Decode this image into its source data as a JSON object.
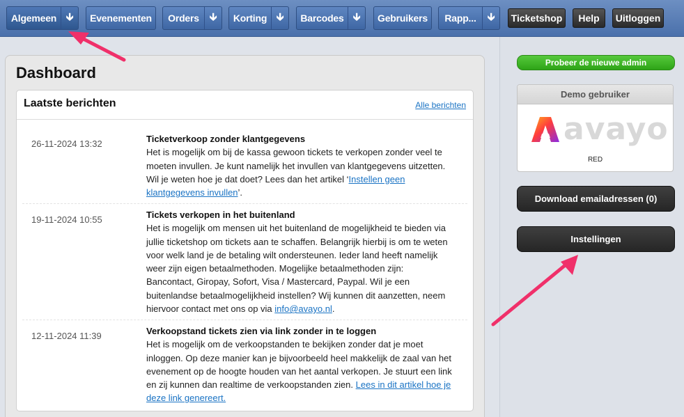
{
  "nav": {
    "items": [
      {
        "label": "Algemeen",
        "has_dropdown": true,
        "active": true
      },
      {
        "label": "Evenementen",
        "has_dropdown": false
      },
      {
        "label": "Orders",
        "has_dropdown": true
      },
      {
        "label": "Korting",
        "has_dropdown": true
      },
      {
        "label": "Barcodes",
        "has_dropdown": true
      },
      {
        "label": "Gebruikers",
        "has_dropdown": false
      },
      {
        "label": "Rapp...",
        "has_dropdown": true
      }
    ],
    "dropdown_icon": "arrow-down-icon",
    "right_buttons": [
      "Ticketshop",
      "Help",
      "Uitloggen"
    ]
  },
  "main": {
    "page_title": "Dashboard",
    "messages_card": {
      "title": "Laatste berichten",
      "all_link": "Alle berichten",
      "messages": [
        {
          "date": "26-11-2024 13:32",
          "title": "Ticketverkoop zonder klantgegevens",
          "text": "Het is mogelijk om bij de kassa gewoon tickets te verkopen zonder veel te moeten invullen. Je kunt namelijk het invullen van klantgegevens uitzetten. Wil je weten hoe je dat doet? Lees dan het artikel ‘",
          "link": "Instellen geen klantgegevens invullen",
          "after": "’."
        },
        {
          "date": "19-11-2024 10:55",
          "title": "Tickets verkopen in het buitenland",
          "text": "Het is mogelijk om mensen uit het buitenland de mogelijkheid te bieden via jullie ticketshop om tickets aan te schaffen. Belangrijk hierbij is om te weten voor welk land je de betaling wilt ondersteunen. Ieder land heeft namelijk weer zijn eigen betaalmethoden. Mogelijke betaalmethoden zijn: Bancontact, Giropay, Sofort, Visa / Mastercard, Paypal. Wil je een buitenlandse betaalmogelijkheid instellen? Wij kunnen dit aanzetten, neem hiervoor contact met ons op via ",
          "link": "info@avayo.nl",
          "after": "."
        },
        {
          "date": "12-11-2024 11:39",
          "title": "Verkoopstand tickets zien via link zonder in te loggen",
          "text": "Het is mogelijk om de verkoopstanden te bekijken zonder dat je moet inloggen. Op deze manier kan je bijvoorbeeld heel makkelijk de zaal van het evenement op de hoogte houden van het aantal verkopen. Je stuurt een link en zij kunnen dan realtime de verkoopstanden zien. ",
          "link": "Lees in dit artikel hoe je deze link genereert. ",
          "after": ""
        }
      ]
    }
  },
  "sidebar": {
    "try_new_admin": "Probeer de nieuwe admin",
    "demo": {
      "header": "Demo gebruiker",
      "logo_text": "avayo",
      "logo_icon": "avayo-logo-icon",
      "subtitle": "RED"
    },
    "download_button": "Download emailadressen (0)",
    "settings_button": "Instellingen"
  },
  "colors": {
    "nav_bg": "#4a70ab",
    "accent_green": "#2ea417",
    "link": "#1a73c4",
    "annotation_arrow": "#f0306a"
  }
}
